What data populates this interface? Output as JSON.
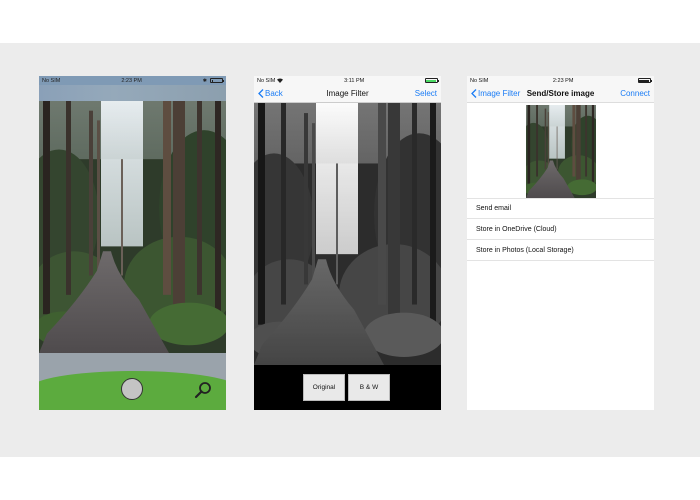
{
  "colors": {
    "ios_blue": "#1a7cf5",
    "battery_green": "#4cd964",
    "grass_green": "#5cab3e"
  },
  "screens": {
    "camera": {
      "status": {
        "carrier": "No SIM",
        "time": "2:23 PM"
      },
      "icons": [
        "shutter-button",
        "magnifier-icon"
      ]
    },
    "filter": {
      "status": {
        "carrier": "No SIM",
        "time": "3:11 PM"
      },
      "nav": {
        "back": "Back",
        "title": "Image Filter",
        "action": "Select"
      },
      "buttons": {
        "original": "Original",
        "bw": "B & W"
      }
    },
    "store": {
      "status": {
        "carrier": "No SIM",
        "time": "2:23 PM"
      },
      "nav": {
        "back": "Image Filter",
        "title": "Send/Store image",
        "action": "Connect"
      },
      "menu": [
        {
          "label": "Send email"
        },
        {
          "label": "Store in OneDrive (Cloud)"
        },
        {
          "label": "Store in Photos (Local Storage)"
        }
      ]
    }
  }
}
